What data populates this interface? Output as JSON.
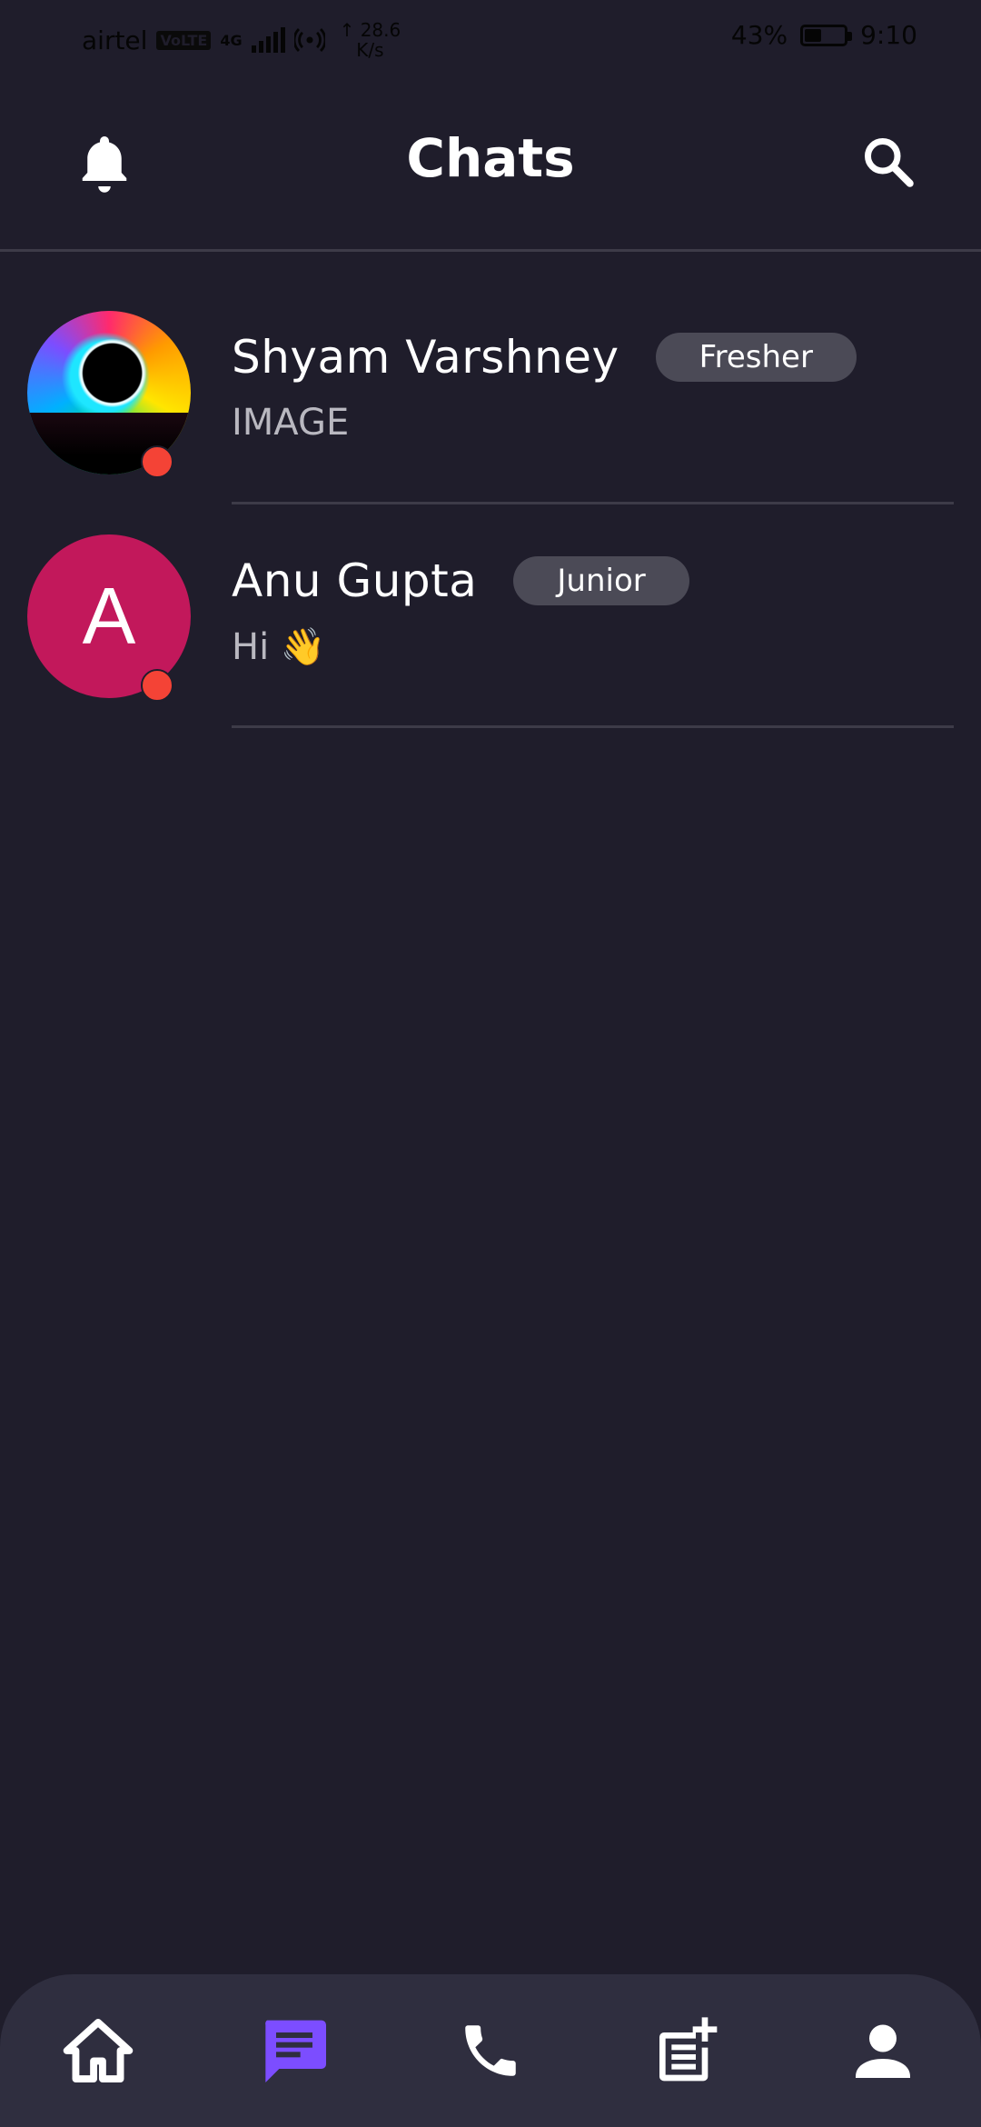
{
  "status_bar": {
    "carrier": "airtel",
    "volte": "VoLTE",
    "network": "4G",
    "speed_value": "↑ 28.6",
    "speed_unit": "K/s",
    "battery_percent": "43%",
    "battery_level": 0.43,
    "time": "9:10"
  },
  "header": {
    "title": "Chats",
    "left_icon": "bell-icon",
    "right_icon": "search-icon"
  },
  "chats": [
    {
      "name": "Shyam Varshney",
      "badge": "Fresher",
      "preview": "IMAGE",
      "avatar_type": "image",
      "online": true
    },
    {
      "name": "Anu Gupta",
      "badge": "Junior",
      "preview_text": "Hi",
      "preview_emoji": "👋",
      "avatar_letter": "A",
      "avatar_color": "#c2185b",
      "online": true
    }
  ],
  "bottom_nav": {
    "items": [
      {
        "icon": "home-icon",
        "active": false
      },
      {
        "icon": "chat-icon",
        "active": true
      },
      {
        "icon": "phone-icon",
        "active": false
      },
      {
        "icon": "post-add-icon",
        "active": false
      },
      {
        "icon": "profile-icon",
        "active": false
      }
    ],
    "active_color": "#7c4dff"
  },
  "colors": {
    "background": "#1f1d2b",
    "nav_background": "#2f2e3f",
    "online_dot": "#f44336",
    "badge_background": "#4b4a56"
  }
}
